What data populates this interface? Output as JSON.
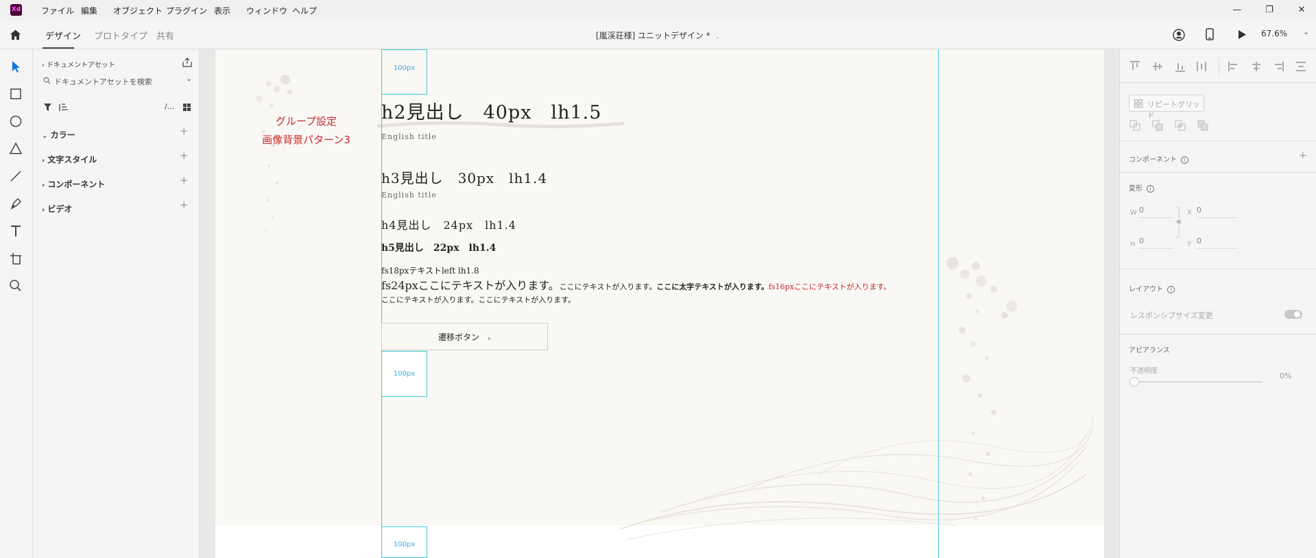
{
  "menu": {
    "app_logo": "Xd",
    "items": [
      "ファイル",
      "編集",
      "オブジェクト",
      "プラグイン",
      "表示",
      "ウィンドウ",
      "ヘルプ"
    ]
  },
  "tabs": {
    "design": "デザイン",
    "prototype": "プロトタイプ",
    "share": "共有"
  },
  "document": {
    "title": "[嵐渓荘様] ユニットデザイン *",
    "zoom": "67.6%"
  },
  "assets_panel": {
    "back_label": "ドキュメントアセット",
    "search_placeholder": "ドキュメントアセットを検索",
    "filter_more": "/...",
    "sections": [
      "カラー",
      "文字スタイル",
      "コンポーネント",
      "ビデオ"
    ]
  },
  "canvas": {
    "spacer_label": "100px",
    "annotation_line1": "グループ設定",
    "annotation_line2": "画像背景パターン3",
    "h2_text": "h2見出し　40px　lh1.5",
    "h2_english": "English title",
    "h3_text": "h3見出し　30px　lh1.4",
    "h3_english": "English title",
    "h4_text": "h4見出し　24px　lh1.4",
    "h5_text": "h5見出し　22px　lh1.4",
    "fs18_text": "fs18pxテキストleft lh1.8",
    "fs24_text": "fs24pxここにテキストが入ります。",
    "normal_text": "ここにテキストが入ります。",
    "bold_text": "ここに太字テキストが入ります。",
    "red_text": "fs16pxここにテキストが入ります。",
    "line2_text": "ここにテキストが入ります。ここにテキストが入ります。",
    "button_label": "遷移ボタン",
    "button_arrow": "▸",
    "accent_red": "#c8282d",
    "guide_color": "#3ec8d8"
  },
  "properties_panel": {
    "repeat_grid": "リピートグリッド",
    "component_label": "コンポーネント",
    "transform_label": "変形",
    "w_label": "W",
    "w_value": "0",
    "h_label": "H",
    "h_value": "0",
    "x_label": "X",
    "x_value": "0",
    "y_label": "Y",
    "y_value": "0",
    "layout_label": "レイアウト",
    "responsive_label": "レスポンシブサイズ変更",
    "appearance_label": "アピアランス",
    "opacity_label": "不透明度",
    "opacity_value": "0%"
  }
}
